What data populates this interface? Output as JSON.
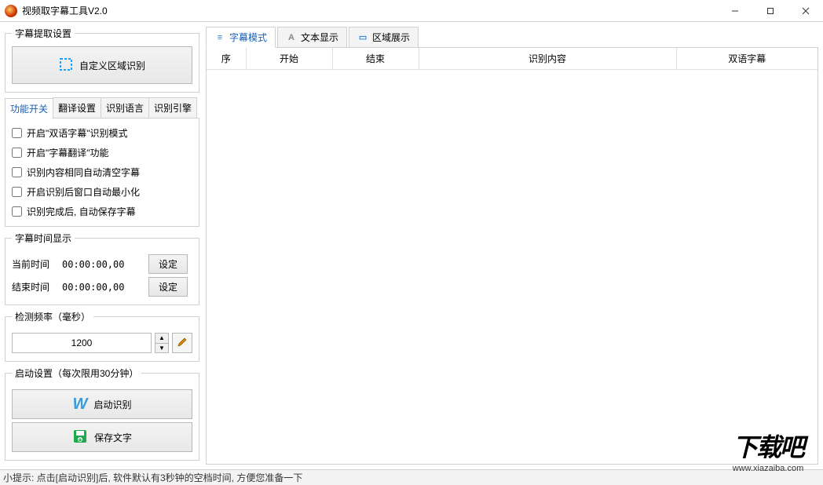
{
  "window": {
    "title": "视频取字幕工具V2.0"
  },
  "left": {
    "extract_group": "字幕提取设置",
    "custom_area_btn": "自定义区域识别",
    "tabs": [
      "功能开关",
      "翻译设置",
      "识别语言",
      "识别引擎"
    ],
    "checks": [
      "开启\"双语字幕\"识别模式",
      "开启\"字幕翻译\"功能",
      "识别内容相同自动清空字幕",
      "开启识别后窗口自动最小化",
      "识别完成后, 自动保存字幕"
    ],
    "time_group": "字幕时间显示",
    "time_rows": [
      {
        "label": "当前时间",
        "value": "00:00:00,00",
        "btn": "设定"
      },
      {
        "label": "结束时间",
        "value": "00:00:00,00",
        "btn": "设定"
      }
    ],
    "freq_group": "检测频率（毫秒）",
    "freq_value": "1200",
    "launch_group": "启动设置（每次限用30分钟）",
    "start_btn": "启动识别",
    "save_btn": "保存文字"
  },
  "right": {
    "tabs": [
      {
        "label": "字幕模式",
        "icon_color": "#3584e4",
        "icon_glyph": "≡"
      },
      {
        "label": "文本显示",
        "icon_color": "#888",
        "icon_glyph": "A"
      },
      {
        "label": "区域展示",
        "icon_color": "#3584e4",
        "icon_glyph": "▭"
      }
    ],
    "columns": [
      {
        "label": "序",
        "width": "50"
      },
      {
        "label": "开始",
        "width": "110"
      },
      {
        "label": "结束",
        "width": "110"
      },
      {
        "label": "识别内容",
        "width": ""
      },
      {
        "label": "双语字幕",
        "width": "180"
      }
    ],
    "rows": []
  },
  "status": "小提示: 点击[启动识别]后, 软件默认有3秒钟的空档时间, 方便您准备一下",
  "watermark": {
    "big": "下载吧",
    "url": "www.xiazaiba.com"
  }
}
